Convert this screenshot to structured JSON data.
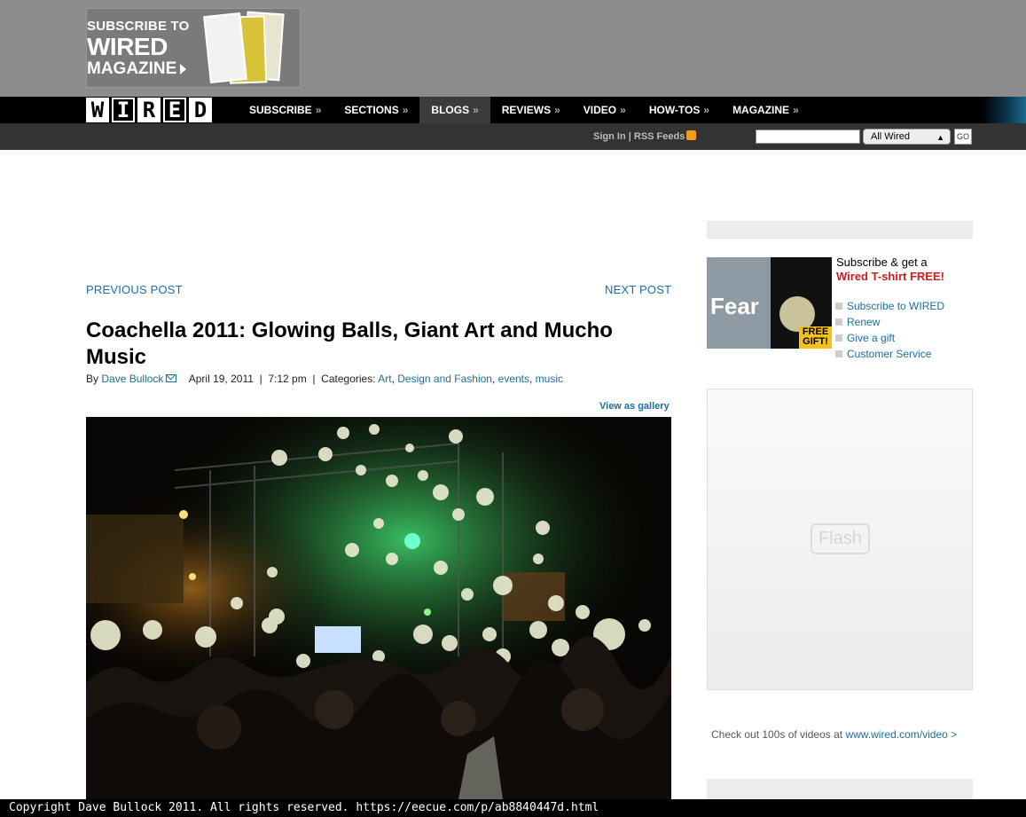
{
  "promo": {
    "line1": "SUBSCRIBE TO",
    "line2": "WIRED",
    "line3": "MAGAZINE"
  },
  "logo": [
    "W",
    "I",
    "R",
    "E",
    "D"
  ],
  "nav": {
    "items": [
      {
        "label": "SUBSCRIBE",
        "arrow": "»"
      },
      {
        "label": "SECTIONS",
        "arrow": "»"
      },
      {
        "label": "BLOGS",
        "arrow": "»"
      },
      {
        "label": "REVIEWS",
        "arrow": "»"
      },
      {
        "label": "VIDEO",
        "arrow": "»"
      },
      {
        "label": "HOW-TOS",
        "arrow": "»"
      },
      {
        "label": "MAGAZINE",
        "arrow": "»"
      }
    ]
  },
  "subbar": {
    "signin": "Sign In",
    "sep": " | ",
    "rss": "RSS Feeds",
    "search_value": "",
    "scope": "All Wired",
    "go": "GO"
  },
  "post": {
    "prev": "PREVIOUS POST",
    "next": "NEXT POST",
    "title": "Coachella 2011: Glowing Balls, Giant Art and Mucho Music",
    "by": "By",
    "author": "Dave Bullock",
    "date": "April 19, 2011",
    "time": "7:12 pm",
    "categories_label": "Categories:",
    "categories": [
      "Art",
      "Design and Fashion",
      "events",
      "music"
    ],
    "gallery": "View as gallery"
  },
  "sidebar": {
    "sub_head1": "Subscribe & get a",
    "sub_head2": "Wired T-shirt FREE!",
    "links": [
      "Subscribe to WIRED",
      "Renew",
      "Give a gift",
      "Customer Service"
    ],
    "mag_cover_text": "Fear",
    "free_gift": "FREE GIFT!",
    "flash": "Flash",
    "videos_text": "Check out 100s of videos at",
    "videos_link": "www.wired.com/video",
    "videos_arrow": ">"
  },
  "footer": "Copyright Dave Bullock 2011. All rights reserved. https://eecue.com/p/ab8840447d.html",
  "colors": {
    "link": "#1a6f9e",
    "nav_bg": "#000000",
    "subbar_bg": "#333333",
    "top_bg": "#8c8c8c",
    "accent_red": "#d21b1b"
  }
}
